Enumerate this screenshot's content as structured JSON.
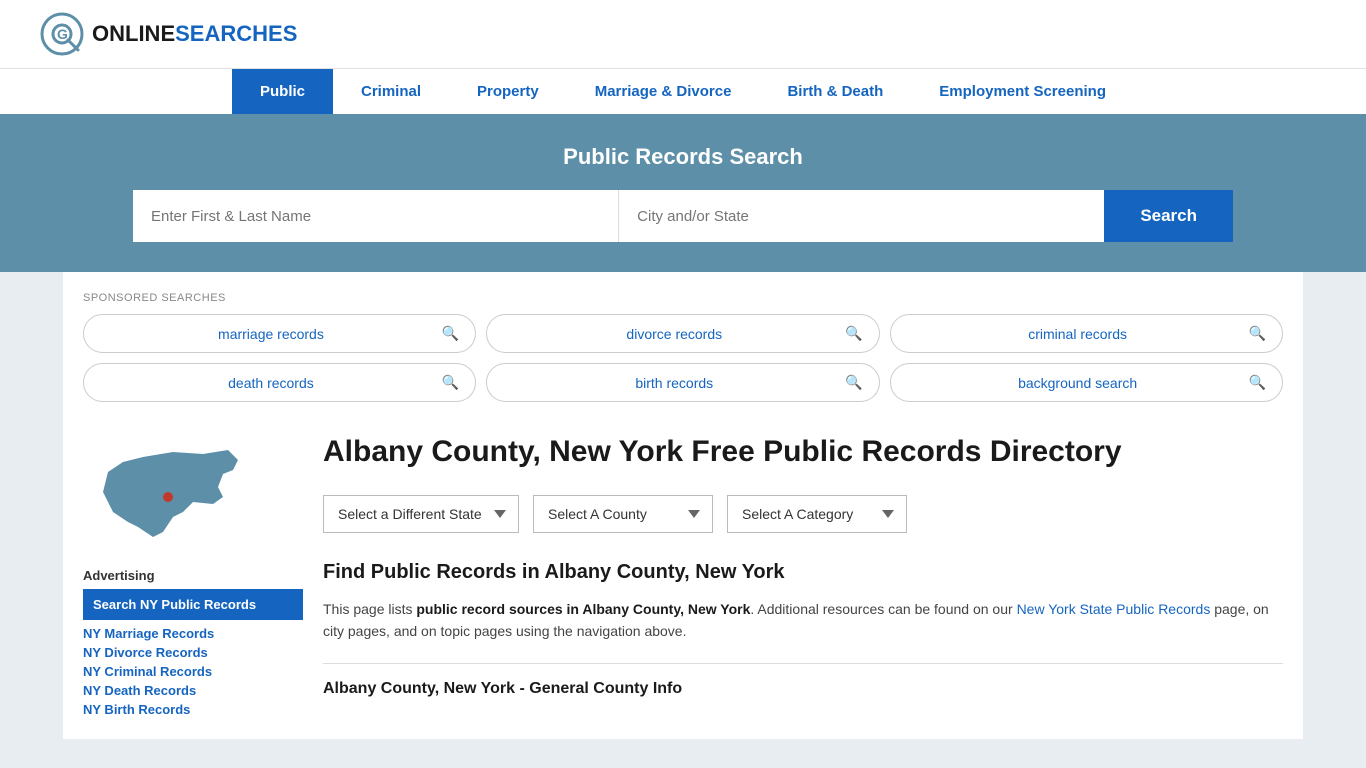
{
  "header": {
    "logo_online": "ONLINE",
    "logo_searches": "SEARCHES"
  },
  "nav": {
    "items": [
      {
        "label": "Public",
        "active": true
      },
      {
        "label": "Criminal",
        "active": false
      },
      {
        "label": "Property",
        "active": false
      },
      {
        "label": "Marriage & Divorce",
        "active": false
      },
      {
        "label": "Birth & Death",
        "active": false
      },
      {
        "label": "Employment Screening",
        "active": false
      }
    ]
  },
  "search_banner": {
    "title": "Public Records Search",
    "name_placeholder": "Enter First & Last Name",
    "city_placeholder": "City and/or State",
    "button_label": "Search"
  },
  "sponsored": {
    "label": "SPONSORED SEARCHES",
    "items": [
      {
        "label": "marriage records"
      },
      {
        "label": "divorce records"
      },
      {
        "label": "criminal records"
      },
      {
        "label": "death records"
      },
      {
        "label": "birth records"
      },
      {
        "label": "background search"
      }
    ]
  },
  "page": {
    "title": "Albany County, New York Free Public Records Directory",
    "find_heading": "Find Public Records in Albany County, New York",
    "description_1": "This page lists ",
    "description_bold": "public record sources in Albany County, New York",
    "description_2": ". Additional resources can be found on our ",
    "description_link_text": "New York State Public Records",
    "description_3": " page, on city pages, and on topic pages using the navigation above.",
    "section_heading": "Albany County, New York - General County Info"
  },
  "dropdowns": {
    "state_label": "Select a Different State",
    "county_label": "Select A County",
    "category_label": "Select A Category"
  },
  "sidebar": {
    "advertising_label": "Advertising",
    "highlight_label": "Search NY Public Records",
    "links": [
      {
        "label": "NY Marriage Records"
      },
      {
        "label": "NY Divorce Records"
      },
      {
        "label": "NY Criminal Records"
      },
      {
        "label": "NY Death Records"
      },
      {
        "label": "NY Birth Records"
      }
    ]
  }
}
